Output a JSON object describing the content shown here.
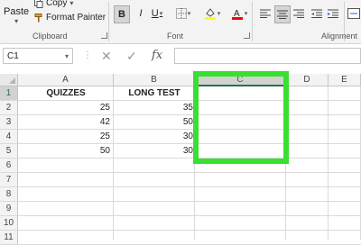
{
  "ribbon": {
    "clipboard": {
      "paste_label": "Paste",
      "copy_label": "Copy",
      "copy_arrow": "▾",
      "format_painter_label": "Format Painter",
      "group_label": "Clipboard"
    },
    "font": {
      "bold_label": "B",
      "italic_label": "I",
      "underline_label": "U",
      "group_label": "Font",
      "fill_color": "#ffff00",
      "font_color": "#ff0000"
    },
    "alignment": {
      "group_label": "Alignment"
    }
  },
  "formula_bar": {
    "name_box_value": "C1",
    "name_box_arrow": "▾",
    "dots": "⋮",
    "cancel_glyph": "✕",
    "enter_glyph": "✓",
    "fx_label": "fx",
    "formula_value": ""
  },
  "grid": {
    "columns": [
      "A",
      "B",
      "C",
      "D",
      "E"
    ],
    "selected_column": "C",
    "rows": [
      "1",
      "2",
      "3",
      "4",
      "5",
      "6",
      "7",
      "8",
      "9",
      "10",
      "11"
    ],
    "selected_row": "1",
    "header_row": {
      "a": "QUIZZES",
      "b": "LONG TEST"
    },
    "data": [
      {
        "a": "25",
        "b": "35"
      },
      {
        "a": "42",
        "b": "50"
      },
      {
        "a": "25",
        "b": "30"
      },
      {
        "a": "50",
        "b": "30"
      }
    ],
    "highlight_color": "#3adf32",
    "accent_color": "#217346"
  }
}
